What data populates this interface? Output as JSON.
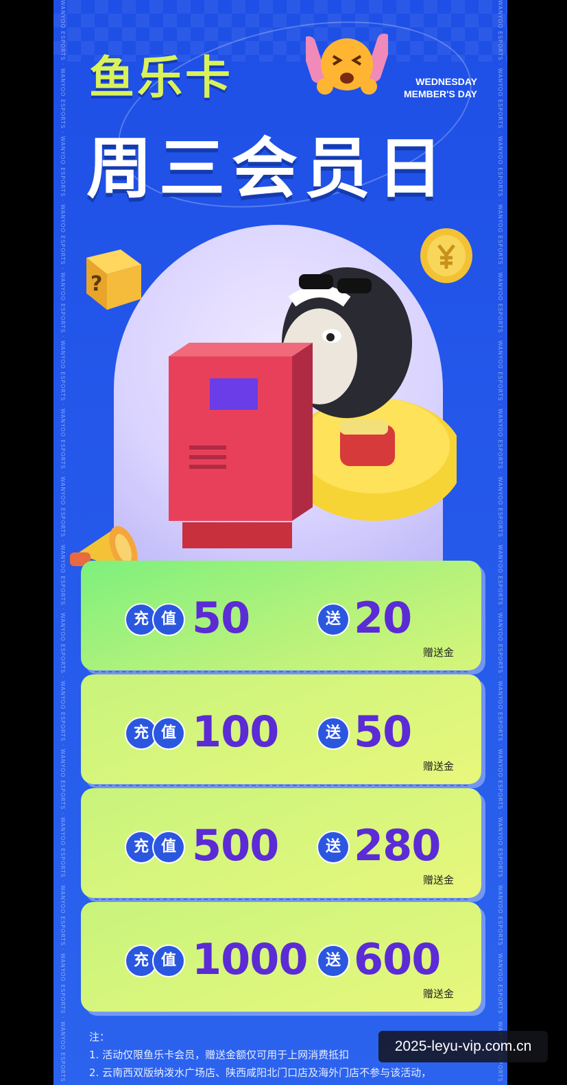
{
  "brand": "鱼乐卡",
  "headline": "周三会员日",
  "subtitle_en": [
    "WEDNESDAY",
    "MEMBER'S DAY"
  ],
  "side_text": "WANYOO ESPORTS",
  "tiers": [
    {
      "recharge_label": [
        "充",
        "值"
      ],
      "recharge": "50",
      "bonus_label": "送",
      "bonus": "20",
      "unit": "赠送金"
    },
    {
      "recharge_label": [
        "充",
        "值"
      ],
      "recharge": "100",
      "bonus_label": "送",
      "bonus": "50",
      "unit": "赠送金"
    },
    {
      "recharge_label": [
        "充",
        "值"
      ],
      "recharge": "500",
      "bonus_label": "送",
      "bonus": "280",
      "unit": "赠送金"
    },
    {
      "recharge_label": [
        "充",
        "值"
      ],
      "recharge": "1000",
      "bonus_label": "送",
      "bonus": "600",
      "unit": "赠送金"
    }
  ],
  "notes": {
    "title": "注：",
    "lines": [
      "1. 活动仅限鱼乐卡会员，赠送金额仅可用于上网消费抵扣",
      "2. 云南西双版纳泼水广场店、陕西咸阳北门口店及海外门店不参与该活动，"
    ]
  },
  "watermark": "2025-leyu-vip.com.cn",
  "colors": {
    "background": "#2457ea",
    "brand": "#d9f25a",
    "amount": "#5b2bd6",
    "chip": "#2b57e0"
  }
}
